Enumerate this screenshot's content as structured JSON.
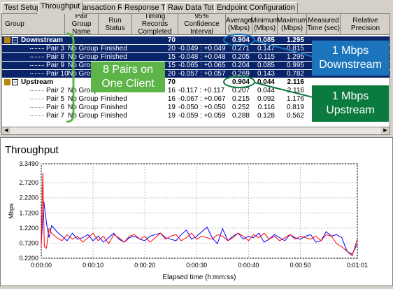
{
  "tabs": [
    {
      "label": "Test Setup"
    },
    {
      "label": "Throughput"
    },
    {
      "label": "Transaction Rate"
    },
    {
      "label": "Response Time"
    },
    {
      "label": "Raw Data Totals"
    },
    {
      "label": "Endpoint Configuration"
    }
  ],
  "grid": {
    "headers": {
      "group": "Group",
      "pair_group": "Pair Group Name",
      "run_status": "Run Status",
      "timing": "Timing Records Completed",
      "ci": "95% Confidence Interval",
      "avg": "Average (Mbps)",
      "min": "Minimum (Mbps)",
      "max": "Maximum (Mbps)",
      "measured": "Measured Time (sec)",
      "relprec": "Relative Precision"
    },
    "downstream": {
      "name": "Downstream",
      "records": "70",
      "avg": "0.904",
      "min": "0.085",
      "max": "1.295"
    },
    "downstream_pairs": [
      {
        "pair": "Pair 3",
        "group": "No Group",
        "status": "Finished",
        "records": "20",
        "ci": "-0.049 : +0.049",
        "avg": "0.271",
        "min": "0.147",
        "max": "0.815"
      },
      {
        "pair": "Pair 8",
        "group": "No Group",
        "status": "Finished",
        "records": "15",
        "ci": "-0.048 : +0.048",
        "avg": "0.205",
        "min": "0.115",
        "max": "1.295"
      },
      {
        "pair": "Pair 9",
        "group": "No Group",
        "status": "Finished",
        "records": "15",
        "ci": "-0.065 : +0.065",
        "avg": "0.204",
        "min": "0.085",
        "max": "0.995"
      },
      {
        "pair": "Pair 10",
        "group": "No Group",
        "status": "Finished",
        "records": "20",
        "ci": "-0.057 : +0.057",
        "avg": "0.269",
        "min": "0.143",
        "max": "0.782"
      }
    ],
    "upstream": {
      "name": "Upstream",
      "records": "70",
      "avg": "0.904",
      "min": "0.044",
      "max": "2.116"
    },
    "upstream_pairs": [
      {
        "pair": "Pair 2",
        "group": "No Group",
        "status": "Finished",
        "records": "16",
        "ci": "-0.117 : +0.117",
        "avg": "0.207",
        "min": "0.044",
        "max": "2.116"
      },
      {
        "pair": "Pair 5",
        "group": "No Group",
        "status": "Finished",
        "records": "16",
        "ci": "-0.067 : +0.067",
        "avg": "0.215",
        "min": "0.092",
        "max": "1.176"
      },
      {
        "pair": "Pair 6",
        "group": "No Group",
        "status": "Finished",
        "records": "19",
        "ci": "-0.050 : +0.050",
        "avg": "0.252",
        "min": "0.116",
        "max": "0.819"
      },
      {
        "pair": "Pair 7",
        "group": "No Group",
        "status": "Finished",
        "records": "19",
        "ci": "-0.059 : +0.059",
        "avg": "0.288",
        "min": "0.128",
        "max": "0.562"
      }
    ]
  },
  "callouts": {
    "pairs": "8 Pairs on One Client",
    "down": "1 Mbps Downstream",
    "up": "1 Mbps Upstream"
  },
  "colors": {
    "selection": "#0a246a",
    "callout_blue": "#1c75bc",
    "callout_green": "#0b7a3e",
    "down_series": "#0000ff",
    "up_series": "#ff0000"
  },
  "chart_data": {
    "type": "line",
    "title": "Throughput",
    "xlabel": "Elapsed time (h:mm:ss)",
    "ylabel": "Mbps",
    "ylim": [
      0.22,
      3.349
    ],
    "yticks": [
      "3.3490",
      "2.7200",
      "2.2200",
      "1.7200",
      "1.2200",
      "0.7200",
      "0.2200"
    ],
    "ytick_values": [
      3.349,
      2.72,
      2.22,
      1.72,
      1.22,
      0.72,
      0.22
    ],
    "xticks": [
      "0:00:00",
      "0:00:10",
      "0:00:20",
      "0:00:30",
      "0:00:40",
      "0:00:50",
      "0:01:01"
    ],
    "xtick_values": [
      0,
      10,
      20,
      30,
      40,
      50,
      61
    ],
    "xlim": [
      0,
      61
    ],
    "grid": true,
    "series": [
      {
        "color": "#0000ff",
        "x": [
          0,
          0.5,
          1,
          1.5,
          2,
          3,
          4,
          5,
          6,
          7,
          8,
          9,
          10,
          11,
          12,
          13,
          14,
          15,
          16,
          17,
          18,
          19,
          20,
          21,
          22,
          23,
          24,
          25,
          26,
          27,
          28,
          29,
          30,
          31,
          32,
          33,
          34,
          35,
          36,
          37,
          38,
          39,
          40,
          41,
          42,
          43,
          44,
          45,
          46,
          47,
          48,
          49,
          50,
          51,
          52,
          53,
          54,
          55,
          56,
          57,
          58,
          59,
          60,
          61
        ],
        "y": [
          0.7,
          2.1,
          1.4,
          0.9,
          1.3,
          1.1,
          0.95,
          0.8,
          1.05,
          0.85,
          0.9,
          1.0,
          0.8,
          0.95,
          0.75,
          0.9,
          1.05,
          0.85,
          0.75,
          0.9,
          0.95,
          0.85,
          0.8,
          0.95,
          1.0,
          1.05,
          0.9,
          0.85,
          0.8,
          1.0,
          1.15,
          0.85,
          0.95,
          1.1,
          1.25,
          0.9,
          0.7,
          1.2,
          0.8,
          0.95,
          1.05,
          0.85,
          0.95,
          0.9,
          1.05,
          0.75,
          0.85,
          1.0,
          0.9,
          0.8,
          1.0,
          0.9,
          0.85,
          0.95,
          1.0,
          0.75,
          0.8,
          1.1,
          0.95,
          1.0,
          0.9,
          0.45,
          0.35,
          0.7
        ]
      },
      {
        "color": "#ff0000",
        "x": [
          0,
          0.3,
          0.6,
          1,
          1.5,
          2,
          3,
          4,
          5,
          6,
          7,
          8,
          9,
          10,
          11,
          12,
          13,
          14,
          15,
          16,
          17,
          18,
          19,
          20,
          21,
          22,
          23,
          24,
          25,
          26,
          27,
          28,
          29,
          30,
          31,
          32,
          33,
          34,
          35,
          36,
          37,
          38,
          39,
          40,
          41,
          42,
          43,
          44,
          45,
          46,
          47,
          48,
          49,
          50,
          51,
          52,
          53,
          54,
          55,
          56,
          57,
          58,
          59,
          60,
          61
        ],
        "y": [
          0.6,
          3.05,
          0.6,
          0.55,
          1.2,
          1.05,
          0.9,
          0.8,
          1.0,
          0.85,
          0.95,
          0.75,
          0.9,
          1.05,
          0.8,
          0.95,
          0.7,
          1.0,
          0.9,
          0.75,
          0.95,
          1.0,
          0.85,
          0.95,
          0.75,
          0.9,
          1.05,
          0.85,
          0.95,
          1.0,
          0.8,
          0.9,
          1.05,
          0.85,
          0.95,
          0.9,
          0.85,
          1.0,
          0.95,
          0.8,
          0.9,
          1.05,
          0.95,
          0.8,
          1.0,
          0.9,
          1.05,
          0.85,
          0.95,
          0.8,
          0.9,
          1.0,
          0.85,
          0.95,
          0.9,
          0.85,
          0.95,
          0.8,
          1.0,
          0.95,
          0.7,
          0.6,
          0.45,
          0.3,
          0.85
        ]
      }
    ]
  }
}
